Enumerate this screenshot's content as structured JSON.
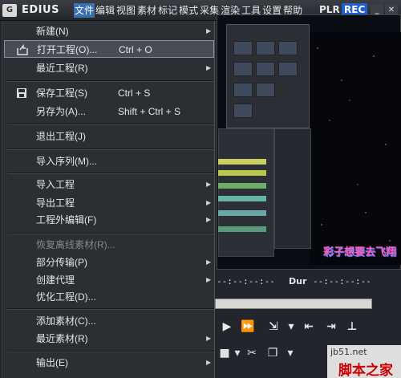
{
  "titlebar": {
    "app_name": "EDIUS",
    "menu": [
      "文件",
      "编辑",
      "视图",
      "素材",
      "标记",
      "模式",
      "采集",
      "渲染",
      "工具",
      "设置",
      "帮助"
    ],
    "active_menu": "文件",
    "plr": "PLR",
    "rec": "REC"
  },
  "file_menu": {
    "items": [
      {
        "label": "新建(N)",
        "submenu": true
      },
      {
        "label": "打开工程(O)...",
        "shortcut": "Ctrl + O",
        "icon": "open-folder-icon"
      },
      {
        "label": "最近工程(R)",
        "submenu": true
      },
      {
        "label": "保存工程(S)",
        "shortcut": "Ctrl + S",
        "icon": "save-disk-icon"
      },
      {
        "label": "另存为(A)...",
        "shortcut": "Shift + Ctrl + S"
      },
      {
        "label": "退出工程(J)"
      },
      {
        "label": "导入序列(M)..."
      },
      {
        "label": "导入工程",
        "submenu": true
      },
      {
        "label": "导出工程",
        "submenu": true
      },
      {
        "label": "工程外编辑(F)",
        "submenu": true
      },
      {
        "label": "恢复离线素材(R)...",
        "disabled": true
      },
      {
        "label": "部分传输(P)",
        "submenu": true
      },
      {
        "label": "创建代理",
        "submenu": true
      },
      {
        "label": "优化工程(D)..."
      },
      {
        "label": "添加素材(C)..."
      },
      {
        "label": "最近素材(R)",
        "submenu": true
      },
      {
        "label": "输出(E)",
        "submenu": true
      }
    ]
  },
  "player": {
    "timecode_in": "--:--:--:--",
    "dur_label": "Dur",
    "timecode_dur": "--:--:--:--"
  },
  "watermark": {
    "overlay_text": "彩子想要去飞翔",
    "site_url": "jb51.net",
    "site_name": "脚本之家"
  },
  "colors": {
    "menu_bg": "#2b2e33",
    "highlight": "#484c55",
    "rec_badge": "#1f5fd0",
    "active_menu": "#3a6fb0"
  }
}
